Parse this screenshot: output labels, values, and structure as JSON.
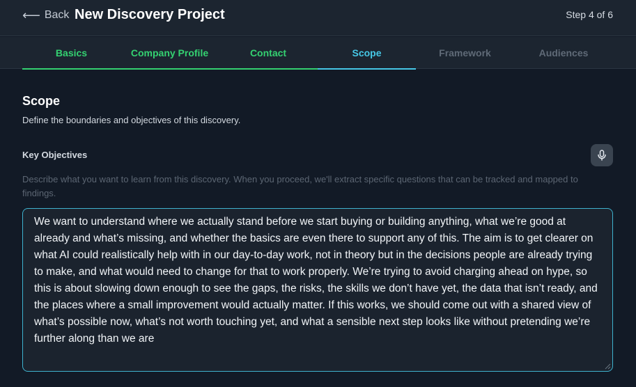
{
  "header": {
    "back_label": "Back",
    "title": "New Discovery Project",
    "step": "Step 4 of 6"
  },
  "tabs": [
    {
      "label": "Basics",
      "state": "complete"
    },
    {
      "label": "Company Profile",
      "state": "complete"
    },
    {
      "label": "Contact",
      "state": "complete"
    },
    {
      "label": "Scope",
      "state": "active"
    },
    {
      "label": "Framework",
      "state": "upcoming"
    },
    {
      "label": "Audiences",
      "state": "upcoming"
    }
  ],
  "section": {
    "title": "Scope",
    "subtitle": "Define the boundaries and objectives of this discovery."
  },
  "key_objectives": {
    "label": "Key Objectives",
    "mic_icon": "microphone-icon",
    "help": "Describe what you want to learn from this discovery. When you proceed, we'll extract specific questions that can be tracked and mapped to findings.",
    "value": "We want to understand where we actually stand before we start buying or building anything, what we’re good at already and what’s missing, and whether the basics are even there to support any of this. The aim is to get clearer on what AI could realistically help with in our day-to-day work, not in theory but in the decisions people are already trying to make, and what would need to change for that to work properly. We’re trying to avoid charging ahead on hype, so this is about slowing down enough to see the gaps, the risks, the skills we don’t have yet, the data that isn’t ready, and the places where a small improvement would actually matter. If this works, we should come out with a shared view of what’s possible now, what’s not worth touching yet, and what a sensible next step looks like without pretending we’re further along than we are"
  },
  "colors": {
    "complete": "#34d171",
    "active": "#46c8e6",
    "upcoming": "#5f6a77",
    "background": "#121a26",
    "panel": "#1c2530"
  }
}
